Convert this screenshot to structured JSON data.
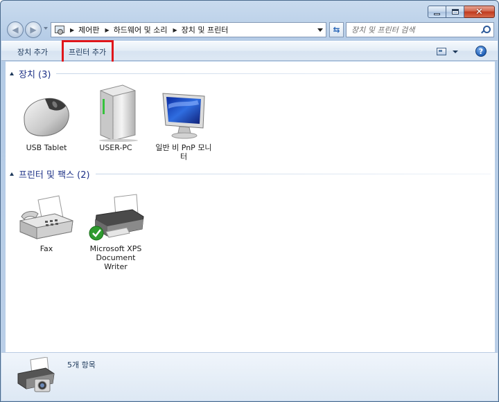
{
  "window": {
    "caption_buttons": {
      "minimize": "minimize-icon",
      "maximize": "maximize-icon",
      "close": "close-icon"
    }
  },
  "nav": {
    "back_icon": "back-arrow-icon",
    "forward_icon": "forward-arrow-icon",
    "breadcrumbs": [
      "제어판",
      "하드웨어 및 소리",
      "장치 및 프린터"
    ],
    "search_placeholder": "장치 및 프린터 검색"
  },
  "toolbar": {
    "add_device": "장치 추가",
    "add_printer": "프린터 추가",
    "view_icon": "change-view-icon",
    "help_icon": "help-icon",
    "help_glyph": "?"
  },
  "groups": [
    {
      "title": "장치 (3)",
      "items": [
        {
          "label": "USB Tablet",
          "icon": "mouse-icon"
        },
        {
          "label": "USER-PC",
          "icon": "computer-tower-icon"
        },
        {
          "label": "일반 비 PnP 모니터",
          "icon": "monitor-icon"
        }
      ]
    },
    {
      "title": "프린터 및 팩스 (2)",
      "items": [
        {
          "label": "Fax",
          "icon": "fax-icon"
        },
        {
          "label": "Microsoft XPS Document Writer",
          "icon": "printer-icon"
        }
      ]
    }
  ],
  "details": {
    "count": "5개 항목",
    "icon": "printer-camera-icon"
  },
  "colors": {
    "highlight": "#e0161b",
    "group_title": "#1e3287",
    "default_check": "#2e9b2e"
  }
}
